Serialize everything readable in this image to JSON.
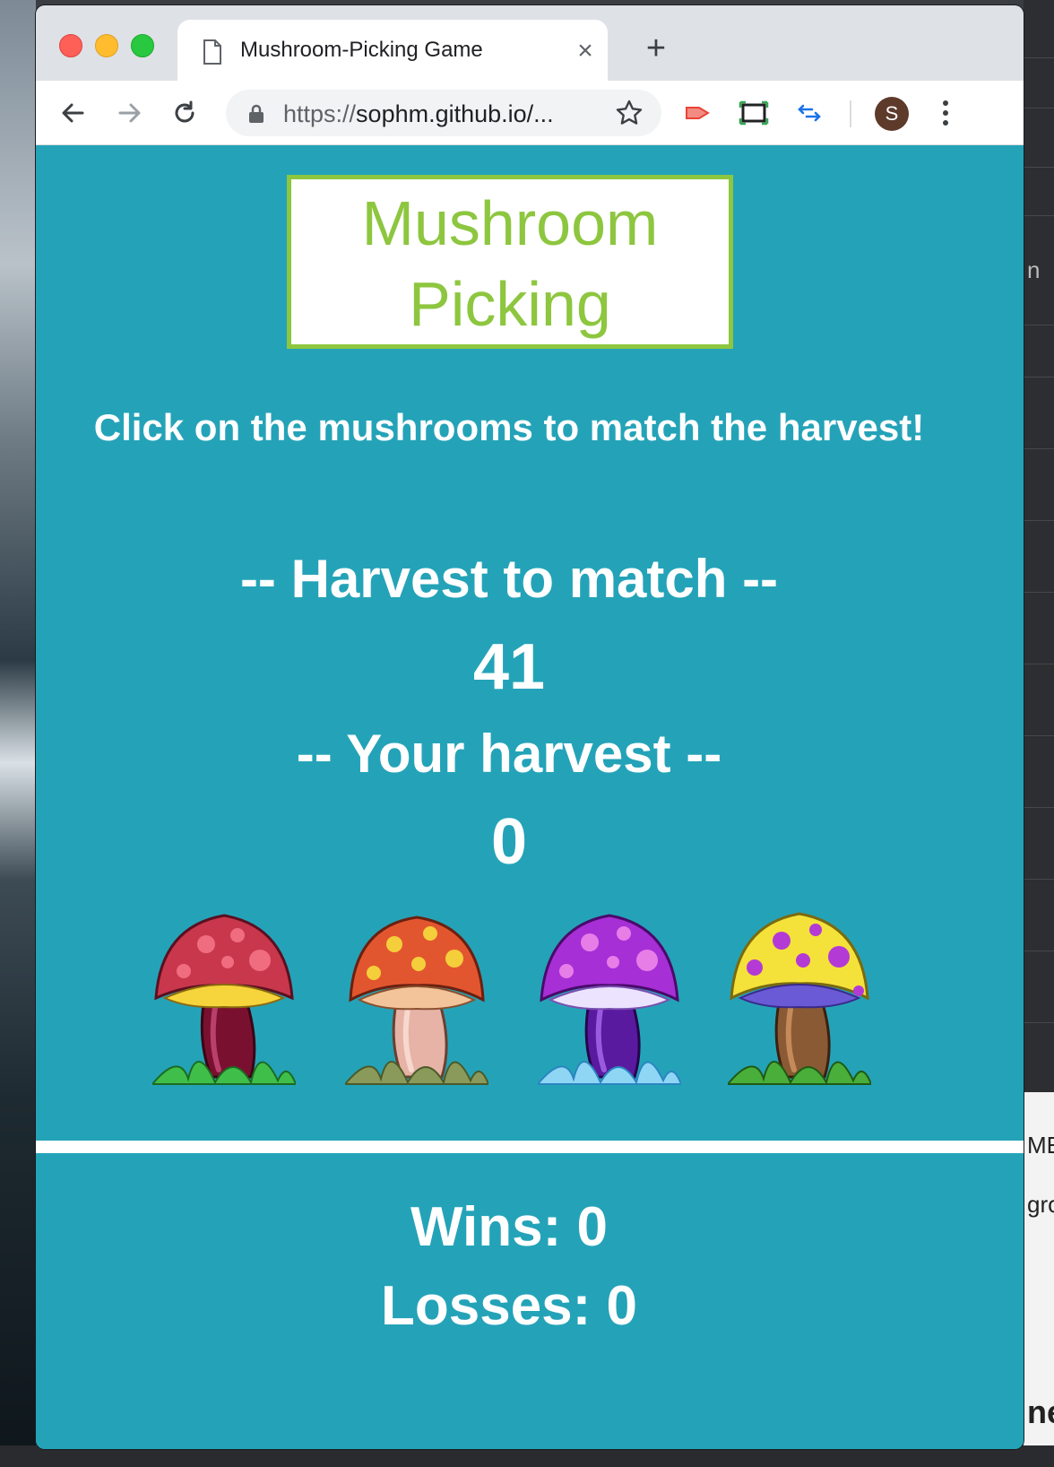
{
  "browser": {
    "tab_title": "Mushroom-Picking Game",
    "tab_close": "×",
    "new_tab": "+",
    "url_scheme": "https://",
    "url_host": "sophm.github.io/...",
    "avatar_initial": "S"
  },
  "game": {
    "title_line1": "Mushroom",
    "title_line2": "Picking",
    "instructions": "Click on the mushrooms to match the harvest!",
    "target_label": "-- Harvest to match --",
    "target_value": "41",
    "harvest_label": "-- Your harvest --",
    "harvest_value": "0",
    "mushrooms": [
      "red-mushroom",
      "orange-mushroom",
      "purple-mushroom",
      "yellow-mushroom"
    ],
    "wins_text": "Wins: 0",
    "losses_text": "Losses: 0"
  },
  "desktop": {
    "fragment_1": "n",
    "fragment_2": "ME.",
    "fragment_3": "gro",
    "fragment_4": "ne"
  },
  "colors": {
    "page_bg": "#24a3b8",
    "title_green": "#8dc63f",
    "text_white": "#ffffff"
  }
}
